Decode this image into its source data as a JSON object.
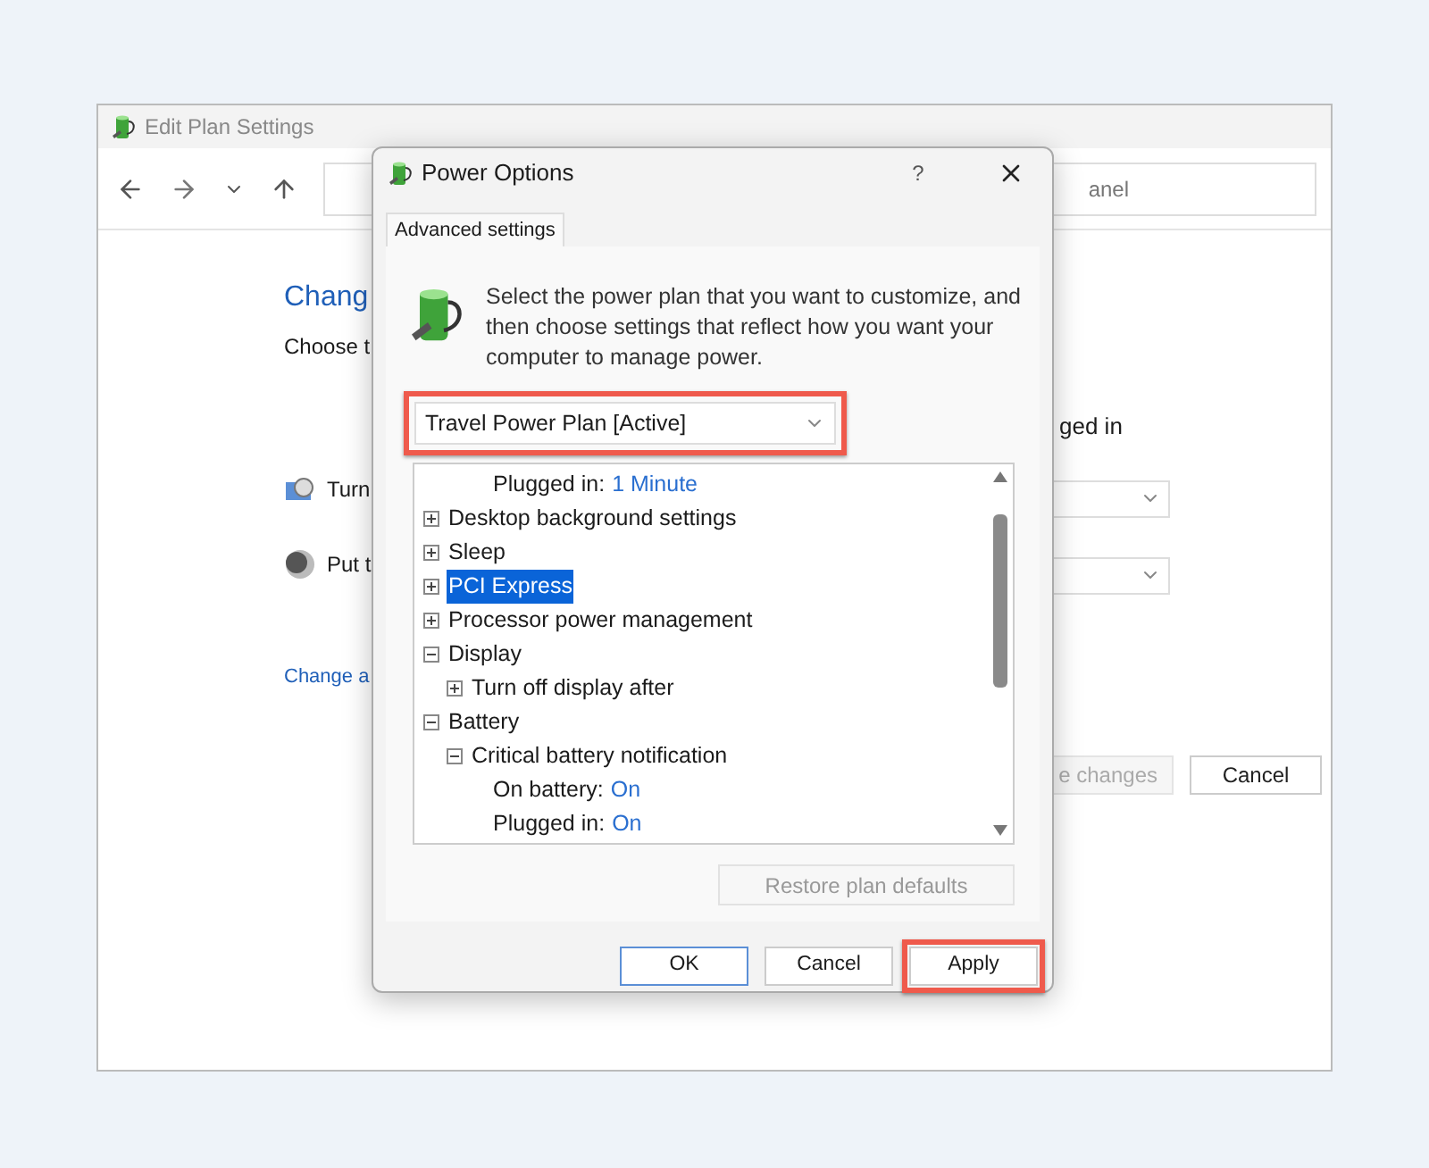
{
  "back_window": {
    "title": "Edit Plan Settings",
    "address_fragment": "anel",
    "heading": "Chang",
    "subheading": "Choose t",
    "column_header_fragment": "ged in",
    "settings": [
      {
        "kind": "display",
        "label": "Turn"
      },
      {
        "kind": "sleep",
        "label": "Put t"
      }
    ],
    "link": "Change a",
    "buttons": [
      {
        "label": "e changes",
        "disabled": true
      },
      {
        "label": "Cancel",
        "disabled": false
      }
    ]
  },
  "dialog": {
    "title": "Power Options",
    "help": "?",
    "tabs": [
      {
        "label": "Advanced settings",
        "selected": true
      }
    ],
    "description": "Select the power plan that you want to customize, and then choose settings that reflect how you want your computer to manage power.",
    "plan_dropdown": {
      "value": "Travel Power Plan [Active]",
      "highlighted": true
    },
    "tree": [
      {
        "children": [
          {
            "children": [
              {
                "kind": "value",
                "label": "Plugged in:",
                "value": "1 Minute"
              }
            ]
          }
        ]
      },
      {
        "kind": "setting",
        "label": "Desktop background settings",
        "expanded": false,
        "selected": false
      },
      {
        "kind": "setting",
        "label": "Sleep",
        "expanded": false,
        "selected": false
      },
      {
        "kind": "setting",
        "label": "PCI Express",
        "expanded": false,
        "selected": true
      },
      {
        "kind": "setting",
        "label": "Processor power management",
        "expanded": false,
        "selected": false
      },
      {
        "kind": "setting",
        "label": "Display",
        "expanded": true,
        "selected": false,
        "children": [
          {
            "kind": "setting",
            "label": "Turn off display after",
            "expanded": false,
            "selected": false
          }
        ]
      },
      {
        "kind": "setting",
        "label": "Battery",
        "expanded": true,
        "selected": false,
        "children": [
          {
            "kind": "setting",
            "label": "Critical battery notification",
            "expanded": true,
            "selected": false,
            "children": [
              {
                "kind": "value",
                "label": "On battery:",
                "value": "On"
              },
              {
                "kind": "value",
                "label": "Plugged in:",
                "value": "On"
              }
            ]
          }
        ]
      }
    ],
    "restore_button": {
      "label": "Restore plan defaults",
      "disabled": true
    },
    "buttons": [
      {
        "label": "OK",
        "default": true,
        "highlighted": false
      },
      {
        "label": "Cancel",
        "default": false,
        "highlighted": false
      },
      {
        "label": "Apply",
        "default": false,
        "highlighted": true
      }
    ]
  }
}
